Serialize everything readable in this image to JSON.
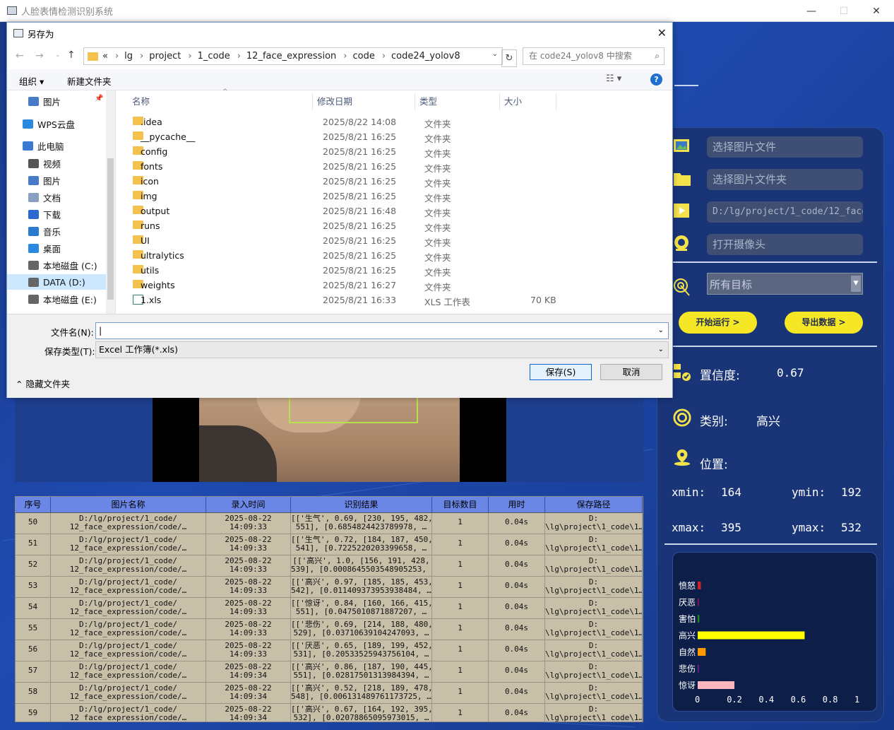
{
  "window": {
    "title": "人脸表情检测识别系统"
  },
  "right_panel": {
    "select_image": "选择图片文件",
    "select_folder": "选择图片文件夹",
    "video_path": "D:/lg/project/1_code/12_face_expression",
    "open_camera": "打开摄像头",
    "target_select": "所有目标",
    "start_button": "开始运行 >",
    "export_button": "导出数据 >",
    "confidence_label": "置信度:",
    "confidence_value": "0.67",
    "class_label": "类别:",
    "class_value": "高兴",
    "position_label": "位置:",
    "xmin_label": "xmin:",
    "xmin_value": "164",
    "ymin_label": "ymin:",
    "ymin_value": "192",
    "xmax_label": "xmax:",
    "xmax_value": "395",
    "ymax_label": "ymax:",
    "ymax_value": "532"
  },
  "chart_data": {
    "type": "bar",
    "orientation": "horizontal",
    "categories": [
      "愤怒",
      "厌恶",
      "害怕",
      "高兴",
      "自然",
      "悲伤",
      "惊讶"
    ],
    "values": [
      0.02,
      0.003,
      0.01,
      0.67,
      0.05,
      0.005,
      0.23
    ],
    "colors": [
      "#cc2222",
      "#a01060",
      "#1a8a1a",
      "#ffff00",
      "#ff9900",
      "#8a1aa0",
      "#ffb6c1"
    ],
    "xlim": [
      0,
      1
    ],
    "xticks": [
      "0",
      "0.2",
      "0.4",
      "0.6",
      "0.8",
      "1"
    ]
  },
  "table": {
    "headers": [
      "序号",
      "图片名称",
      "录入时间",
      "识别结果",
      "目标数目",
      "用时",
      "保存路径"
    ],
    "rows": [
      {
        "id": "50",
        "name": "D:/lg/project/1_code/\n12_face_expression/code/…",
        "time": "2025-08-22\n14:09:33",
        "result": "[['生气', 0.69, [230, 195, 482,\n551], [0.6854824423789978, …",
        "count": "1",
        "cost": "0.04s",
        "path": "D:\n\\lg\\project\\1_code\\1…"
      },
      {
        "id": "51",
        "name": "D:/lg/project/1_code/\n12_face_expression/code/…",
        "time": "2025-08-22\n14:09:33",
        "result": "[['生气', 0.72, [184, 187, 450,\n541], [0.7225220203399658, …",
        "count": "1",
        "cost": "0.04s",
        "path": "D:\n\\lg\\project\\1_code\\1…"
      },
      {
        "id": "52",
        "name": "D:/lg/project/1_code/\n12_face_expression/code/…",
        "time": "2025-08-22\n14:09:33",
        "result": "[['高兴', 1.0, [156, 191, 428,\n539], [0.0008645503548905253, …",
        "count": "1",
        "cost": "0.04s",
        "path": "D:\n\\lg\\project\\1_code\\1…"
      },
      {
        "id": "53",
        "name": "D:/lg/project/1_code/\n12_face_expression/code/…",
        "time": "2025-08-22\n14:09:33",
        "result": "[['高兴', 0.97, [185, 185, 453,\n542], [0.011409373953938484, …",
        "count": "1",
        "cost": "0.04s",
        "path": "D:\n\\lg\\project\\1_code\\1…"
      },
      {
        "id": "54",
        "name": "D:/lg/project/1_code/\n12_face_expression/code/…",
        "time": "2025-08-22\n14:09:33",
        "result": "[['惊讶', 0.84, [160, 166, 415,\n551], [0.0475010871887207, …",
        "count": "1",
        "cost": "0.04s",
        "path": "D:\n\\lg\\project\\1_code\\1…"
      },
      {
        "id": "55",
        "name": "D:/lg/project/1_code/\n12_face_expression/code/…",
        "time": "2025-08-22\n14:09:33",
        "result": "[['悲伤', 0.69, [214, 188, 480,\n529], [0.03710639104247093, …",
        "count": "1",
        "cost": "0.04s",
        "path": "D:\n\\lg\\project\\1_code\\1…"
      },
      {
        "id": "56",
        "name": "D:/lg/project/1_code/\n12_face_expression/code/…",
        "time": "2025-08-22\n14:09:33",
        "result": "[['厌恶', 0.65, [189, 199, 452,\n531], [0.20533525943756104, …",
        "count": "1",
        "cost": "0.04s",
        "path": "D:\n\\lg\\project\\1_code\\1…"
      },
      {
        "id": "57",
        "name": "D:/lg/project/1_code/\n12_face_expression/code/…",
        "time": "2025-08-22\n14:09:34",
        "result": "[['高兴', 0.86, [187, 190, 445,\n551], [0.02817501313984394, …",
        "count": "1",
        "cost": "0.04s",
        "path": "D:\n\\lg\\project\\1_code\\1…"
      },
      {
        "id": "58",
        "name": "D:/lg/project/1_code/\n12_face_expression/code/…",
        "time": "2025-08-22\n14:09:34",
        "result": "[['高兴', 0.52, [218, 189, 478,\n548], [0.006131489761173725, …",
        "count": "1",
        "cost": "0.04s",
        "path": "D:\n\\lg\\project\\1_code\\1…"
      },
      {
        "id": "59",
        "name": "D:/lg/project/1_code/\n12_face_expression/code/…",
        "time": "2025-08-22\n14:09:34",
        "result": "[['高兴', 0.67, [164, 192, 395,\n532], [0.02078865095973015, …",
        "count": "1",
        "cost": "0.04s",
        "path": "D:\n\\lg\\project\\1_code\\1…"
      }
    ]
  },
  "dialog": {
    "title": "另存为",
    "breadcrumb": [
      "«",
      "lg",
      "project",
      "1_code",
      "12_face_expression",
      "code",
      "code24_yolov8"
    ],
    "search_placeholder": "在 code24_yolov8 中搜索",
    "organize": "组织 ▾",
    "new_folder": "新建文件夹",
    "nav": [
      {
        "label": "图片",
        "color": "#4a7bc8"
      },
      {
        "label": "WPS云盘",
        "color": "#2a8ae0"
      },
      {
        "label": "此电脑",
        "color": "#3a7ad0"
      },
      {
        "label": "视频",
        "color": "#555"
      },
      {
        "label": "图片",
        "color": "#4a7bc8"
      },
      {
        "label": "文档",
        "color": "#8aa0c0"
      },
      {
        "label": "下载",
        "color": "#2a6ad0"
      },
      {
        "label": "音乐",
        "color": "#2a7ad0"
      },
      {
        "label": "桌面",
        "color": "#2a8ae0"
      },
      {
        "label": "本地磁盘 (C:)",
        "color": "#666"
      },
      {
        "label": "DATA (D:)",
        "color": "#666"
      },
      {
        "label": "本地磁盘 (E:)",
        "color": "#666"
      }
    ],
    "columns": [
      "名称",
      "修改日期",
      "类型",
      "大小"
    ],
    "files": [
      {
        "name": ".idea",
        "date": "2025/8/22 14:08",
        "type": "文件夹",
        "size": ""
      },
      {
        "name": "__pycache__",
        "date": "2025/8/21 16:25",
        "type": "文件夹",
        "size": ""
      },
      {
        "name": "config",
        "date": "2025/8/21 16:25",
        "type": "文件夹",
        "size": ""
      },
      {
        "name": "fonts",
        "date": "2025/8/21 16:25",
        "type": "文件夹",
        "size": ""
      },
      {
        "name": "icon",
        "date": "2025/8/21 16:25",
        "type": "文件夹",
        "size": ""
      },
      {
        "name": "img",
        "date": "2025/8/21 16:25",
        "type": "文件夹",
        "size": ""
      },
      {
        "name": "output",
        "date": "2025/8/21 16:48",
        "type": "文件夹",
        "size": ""
      },
      {
        "name": "runs",
        "date": "2025/8/21 16:25",
        "type": "文件夹",
        "size": ""
      },
      {
        "name": "UI",
        "date": "2025/8/21 16:25",
        "type": "文件夹",
        "size": ""
      },
      {
        "name": "ultralytics",
        "date": "2025/8/21 16:25",
        "type": "文件夹",
        "size": ""
      },
      {
        "name": "utils",
        "date": "2025/8/21 16:25",
        "type": "文件夹",
        "size": ""
      },
      {
        "name": "weights",
        "date": "2025/8/21 16:27",
        "type": "文件夹",
        "size": ""
      },
      {
        "name": "1.xls",
        "date": "2025/8/21 16:33",
        "type": "XLS 工作表",
        "size": "70 KB"
      }
    ],
    "filename_label": "文件名(N):",
    "filename_value": "",
    "filetype_label": "保存类型(T):",
    "filetype_value": "Excel 工作簿(*.xls)",
    "hide_folders": "隐藏文件夹",
    "save": "保存(S)",
    "cancel": "取消"
  }
}
